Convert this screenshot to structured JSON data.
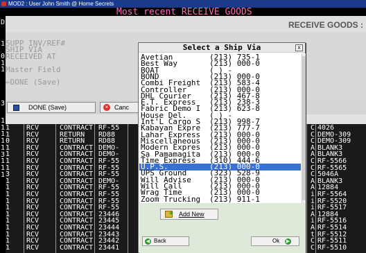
{
  "window": {
    "title": "MOD2 : User John Smith @ Home Secrets"
  },
  "screen": {
    "heading": "Most recent RECEIVE GOODS",
    "module_label": "RECEIVE GOODS :",
    "heading_color": "#ff69b4"
  },
  "left_strip": [
    "D",
    "1",
    "0",
    "1",
    "1",
    "3",
    "1",
    "1",
    "1",
    "1",
    "1",
    "3",
    "1",
    "1",
    "1"
  ],
  "form": {
    "fields": [
      {
        "label": "SUPP INV/REF#"
      },
      {
        "label": "SHIP VIA"
      },
      {
        "label": "RECEIVED AT"
      },
      {
        "label": "Master Field"
      },
      {
        "label": "←DONE (Save)"
      }
    ]
  },
  "toolbar": {
    "done_label": "DONE (Save)",
    "cancel_label": "Canc"
  },
  "table": {
    "rows": [
      {
        "c1": "1",
        "c2": "RCV",
        "c3": "CONTRACT",
        "c4": "RF-55",
        "c5": "C",
        "c6": "4026"
      },
      {
        "c1": "1",
        "c2": "RCV",
        "c3": "RETURN",
        "c4": "RD88",
        "c5": "C",
        "c6": "DEMO-309"
      },
      {
        "c1": "0",
        "c2": "RCV",
        "c3": "RETURN",
        "c4": "RD88",
        "c5": "C",
        "c6": "DEMO-309"
      },
      {
        "c1": "1",
        "c2": "RCV",
        "c3": "CONTRACT",
        "c4": "DEMO-",
        "c5": "A",
        "c6": "BLANK3"
      },
      {
        "c1": "1",
        "c2": "RCV",
        "c3": "CONTRACT",
        "c4": "DEMO-",
        "c5": "A",
        "c6": "BLANK3"
      },
      {
        "c1": "1",
        "c2": "RCV",
        "c3": "CONTRACT",
        "c4": "RF-55",
        "c5": "C",
        "c6": "RF-5566"
      },
      {
        "c1": "1",
        "c2": "RCV",
        "c3": "CONTRACT",
        "c4": "RF-55",
        "c5": "C",
        "c6": "RF-5565"
      },
      {
        "c1": "3",
        "c2": "RCV",
        "c3": "CONTRACT",
        "c4": "RF-55",
        "c5": "C",
        "c6": "5046A"
      },
      {
        "c1": "1",
        "c2": "RCV",
        "c3": "CONTRACT",
        "c4": "DEMO-",
        "c5": "A",
        "c6": "BLANK3"
      },
      {
        "c1": "1",
        "c2": "RCV",
        "c3": "CONTRACT",
        "c4": "RF-55",
        "c5": "A",
        "c6": "12884"
      },
      {
        "c1": "1",
        "c2": "RCV",
        "c3": "CONTRACT",
        "c4": "RF-55",
        "c5": "i",
        "c6": "RF-5564"
      },
      {
        "c1": "1",
        "c2": "RCV",
        "c3": "CONTRACT",
        "c4": "RF-55",
        "c5": "i",
        "c6": "RF-5520"
      },
      {
        "c1": "1",
        "c2": "RCV",
        "c3": "CONTRACT",
        "c4": "RF-55",
        "c5": "i",
        "c6": "RF-5517"
      },
      {
        "c1": "1",
        "c2": "RCV",
        "c3": "CONTRACT",
        "c4": "23446",
        "c5": "A",
        "c6": "12884"
      },
      {
        "c1": "1",
        "c2": "RCV",
        "c3": "CONTRACT",
        "c4": "23445",
        "c5": "i",
        "c6": "RF-5516"
      },
      {
        "c1": "1",
        "c2": "RCV",
        "c3": "CONTRACT",
        "c4": "23444",
        "c5": "A",
        "c6": "RF-5514"
      },
      {
        "c1": "1",
        "c2": "RCV",
        "c3": "CONTRACT",
        "c4": "23443",
        "c5": "t",
        "c6": "RF-5512"
      },
      {
        "c1": "1",
        "c2": "RCV",
        "c3": "CONTRACT",
        "c4": "23442",
        "c5": "C",
        "c6": "RF-5511"
      },
      {
        "c1": "1",
        "c2": "RCV",
        "c3": "CONTRACT",
        "c4": "23441",
        "c5": "C",
        "c6": "RF-5510"
      }
    ]
  },
  "dialog": {
    "title": "Select a Ship Via",
    "close_glyph": "x",
    "items": [
      {
        "name": "Avetian",
        "phone": "(213) 735-1"
      },
      {
        "name": "Best Way",
        "phone": "(213) 000-0"
      },
      {
        "name": "BOAT",
        "phone": "( )  -"
      },
      {
        "name": "BOND",
        "phone": "(213) 000-0"
      },
      {
        "name": "Combi Freight",
        "phone": "(213) 583-4"
      },
      {
        "name": "Controller",
        "phone": "(213) 000-0"
      },
      {
        "name": "DHL Courier",
        "phone": "(213) 467-8"
      },
      {
        "name": "E.T. Express",
        "phone": "(213) 238-3"
      },
      {
        "name": "Fabric Demo I",
        "phone": "(213) 623-8"
      },
      {
        "name": "House Del.",
        "phone": "( )  -"
      },
      {
        "name": "Int'L Cargo S",
        "phone": "(213) 998-7"
      },
      {
        "name": "Kabayan Expre",
        "phone": "(213) 777-7"
      },
      {
        "name": "Lahar Express",
        "phone": "(213) 000-0"
      },
      {
        "name": "Miscellaneous",
        "phone": "(213) 000-0"
      },
      {
        "name": "Modern Expres",
        "phone": "(213) 000-0"
      },
      {
        "name": "Sa Pamamagita",
        "phone": "(213) 000-0"
      },
      {
        "name": "Time Express",
        "phone": "(310) 444-6"
      },
      {
        "name": "U.P.S.",
        "phone": "(213) 000-0"
      },
      {
        "name": "UPS Ground",
        "phone": "(323) 528-9"
      },
      {
        "name": "Will Advise",
        "phone": "(213) 000-0"
      },
      {
        "name": "Will Call",
        "phone": "(213) 000-0"
      },
      {
        "name": "Wrag Time",
        "phone": "(213) 000-0"
      },
      {
        "name": "Zoom Trucking",
        "phone": "(213) 911-1"
      }
    ],
    "selected_index": 17,
    "add_new_label": "Add New",
    "back_label": "Back",
    "ok_label": "Ok"
  }
}
